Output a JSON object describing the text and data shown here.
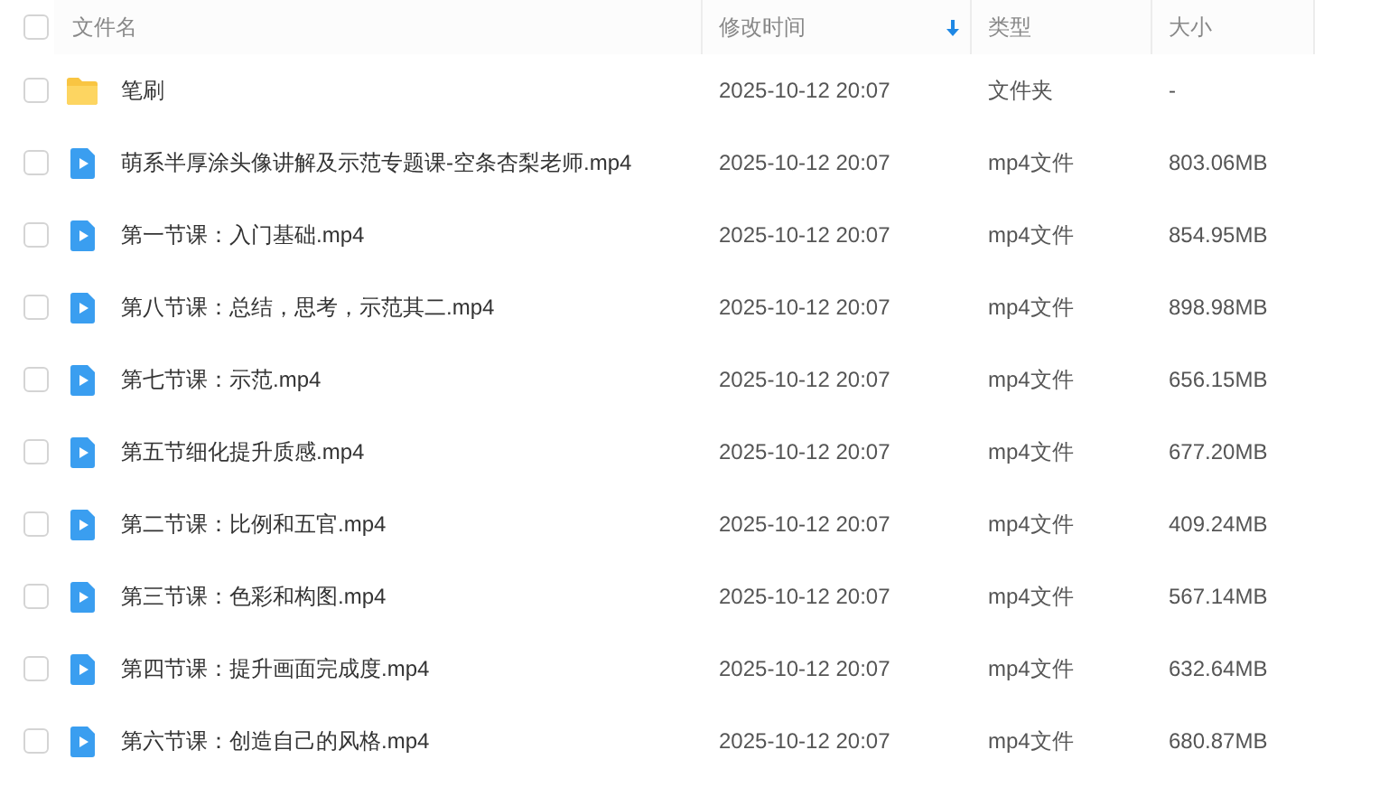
{
  "columns": [
    {
      "label": "文件名",
      "sorted": false
    },
    {
      "label": "修改时间",
      "sorted": true
    },
    {
      "label": "类型",
      "sorted": false
    },
    {
      "label": "大小",
      "sorted": false
    }
  ],
  "header_checked": false,
  "rows": [
    {
      "kind": "folder",
      "name": "笔刷",
      "modified": "2025-10-12 20:07",
      "type": "文件夹",
      "size": "-",
      "checked": false
    },
    {
      "kind": "video",
      "name": "萌系半厚涂头像讲解及示范专题课-空条杏梨老师.mp4",
      "modified": "2025-10-12 20:07",
      "type": "mp4文件",
      "size": "803.06MB",
      "checked": false
    },
    {
      "kind": "video",
      "name": "第一节课：入门基础.mp4",
      "modified": "2025-10-12 20:07",
      "type": "mp4文件",
      "size": "854.95MB",
      "checked": false
    },
    {
      "kind": "video",
      "name": "第八节课：总结，思考，示范其二.mp4",
      "modified": "2025-10-12 20:07",
      "type": "mp4文件",
      "size": "898.98MB",
      "checked": false
    },
    {
      "kind": "video",
      "name": "第七节课：示范.mp4",
      "modified": "2025-10-12 20:07",
      "type": "mp4文件",
      "size": "656.15MB",
      "checked": false
    },
    {
      "kind": "video",
      "name": "第五节细化提升质感.mp4",
      "modified": "2025-10-12 20:07",
      "type": "mp4文件",
      "size": "677.20MB",
      "checked": false
    },
    {
      "kind": "video",
      "name": "第二节课：比例和五官.mp4",
      "modified": "2025-10-12 20:07",
      "type": "mp4文件",
      "size": "409.24MB",
      "checked": false
    },
    {
      "kind": "video",
      "name": "第三节课：色彩和构图.mp4",
      "modified": "2025-10-12 20:07",
      "type": "mp4文件",
      "size": "567.14MB",
      "checked": false
    },
    {
      "kind": "video",
      "name": "第四节课：提升画面完成度.mp4",
      "modified": "2025-10-12 20:07",
      "type": "mp4文件",
      "size": "632.64MB",
      "checked": false
    },
    {
      "kind": "video",
      "name": "第六节课：创造自己的风格.mp4",
      "modified": "2025-10-12 20:07",
      "type": "mp4文件",
      "size": "680.87MB",
      "checked": false
    }
  ]
}
